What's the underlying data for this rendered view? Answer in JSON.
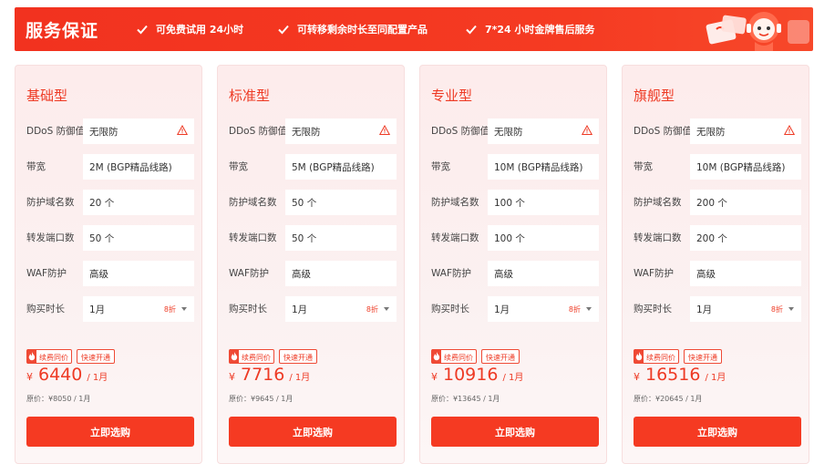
{
  "banner": {
    "title": "服务保证",
    "features": [
      "可免费试用 24小时",
      "可转移剩余时长至同配置产品",
      "7*24 小时金牌售后服务"
    ]
  },
  "colors": {
    "accent": "#f53a22",
    "text_accent": "#ee3a24"
  },
  "cards": [
    {
      "title": "基础型",
      "ddos_label": "DDoS 防御值",
      "ddos_value": "无限防",
      "bandwidth_label": "带宽",
      "bandwidth_value": "2M (BGP精品线路)",
      "domains_label": "防护域名数",
      "domains_value": "20 个",
      "ports_label": "转发端口数",
      "ports_value": "50 个",
      "waf_label": "WAF防护",
      "waf_value": "高级",
      "duration_label": "购买时长",
      "duration_value": "1月",
      "discount": "8折",
      "tag1": "续费同价",
      "tag2": "快速开通",
      "currency": "¥",
      "price": "6440",
      "price_unit": "/ 1月",
      "original": "原价：¥8050 / 1月",
      "buy_label": "立即选购"
    },
    {
      "title": "标准型",
      "ddos_label": "DDoS 防御值",
      "ddos_value": "无限防",
      "bandwidth_label": "带宽",
      "bandwidth_value": "5M (BGP精品线路)",
      "domains_label": "防护域名数",
      "domains_value": "50 个",
      "ports_label": "转发端口数",
      "ports_value": "50 个",
      "waf_label": "WAF防护",
      "waf_value": "高级",
      "duration_label": "购买时长",
      "duration_value": "1月",
      "discount": "8折",
      "tag1": "续费同价",
      "tag2": "快速开通",
      "currency": "¥",
      "price": "7716",
      "price_unit": "/ 1月",
      "original": "原价：¥9645 / 1月",
      "buy_label": "立即选购"
    },
    {
      "title": "专业型",
      "ddos_label": "DDoS 防御值",
      "ddos_value": "无限防",
      "bandwidth_label": "带宽",
      "bandwidth_value": "10M (BGP精品线路)",
      "domains_label": "防护域名数",
      "domains_value": "100 个",
      "ports_label": "转发端口数",
      "ports_value": "100 个",
      "waf_label": "WAF防护",
      "waf_value": "高级",
      "duration_label": "购买时长",
      "duration_value": "1月",
      "discount": "8折",
      "tag1": "续费同价",
      "tag2": "快速开通",
      "currency": "¥",
      "price": "10916",
      "price_unit": "/ 1月",
      "original": "原价：¥13645 / 1月",
      "buy_label": "立即选购"
    },
    {
      "title": "旗舰型",
      "ddos_label": "DDoS 防御值",
      "ddos_value": "无限防",
      "bandwidth_label": "带宽",
      "bandwidth_value": "10M (BGP精品线路)",
      "domains_label": "防护域名数",
      "domains_value": "200 个",
      "ports_label": "转发端口数",
      "ports_value": "200 个",
      "waf_label": "WAF防护",
      "waf_value": "高级",
      "duration_label": "购买时长",
      "duration_value": "1月",
      "discount": "8折",
      "tag1": "续费同价",
      "tag2": "快速开通",
      "currency": "¥",
      "price": "16516",
      "price_unit": "/ 1月",
      "original": "原价：¥20645 / 1月",
      "buy_label": "立即选购"
    }
  ]
}
